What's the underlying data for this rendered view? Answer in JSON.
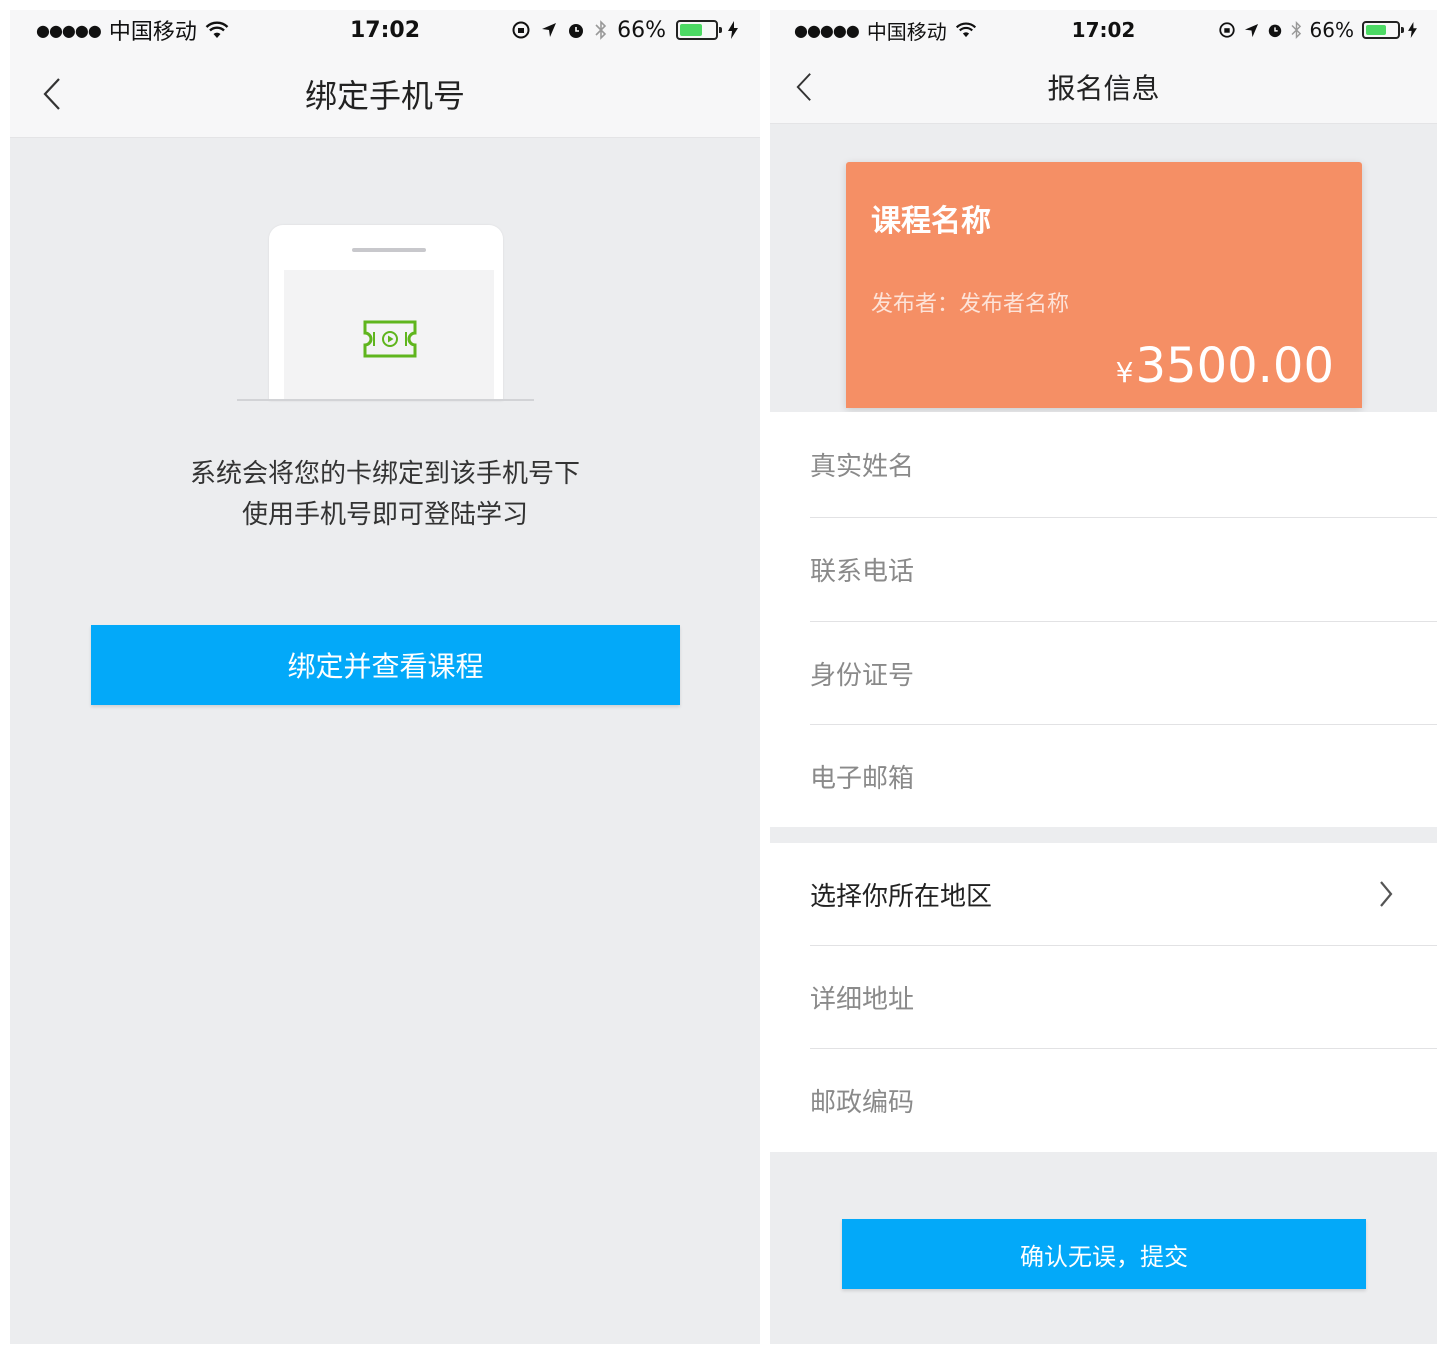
{
  "status_bar": {
    "signal": "●●●●●",
    "carrier": "中国移动",
    "time": "17:02",
    "battery_percent": "66%",
    "battery_level": 0.66
  },
  "bind_screen": {
    "nav_title": "绑定手机号",
    "description_line_1": "系统会将您的卡绑定到该手机号下",
    "description_line_2": "使用手机号即可登陆学习",
    "bind_button_label": "绑定并查看课程",
    "colors": {
      "primary": "#03a9f9",
      "ticket_icon": "#5fb51d"
    }
  },
  "signup_screen": {
    "nav_title": "报名信息",
    "course_card": {
      "course_name": "课程名称",
      "publisher_label": "发布者：",
      "publisher_name": "发布者名称",
      "price_symbol": "¥",
      "price": "3500.00",
      "color": "#f58f65"
    },
    "form_fields": [
      {
        "placeholder": "真实姓名"
      },
      {
        "placeholder": "联系电话"
      },
      {
        "placeholder": "身份证号"
      },
      {
        "placeholder": "电子邮箱"
      }
    ],
    "address_fields": {
      "region_select": "选择你所在地区",
      "detail_address": "详细地址",
      "postal_code": "邮政编码"
    },
    "submit_button_label": "确认无误，提交"
  }
}
